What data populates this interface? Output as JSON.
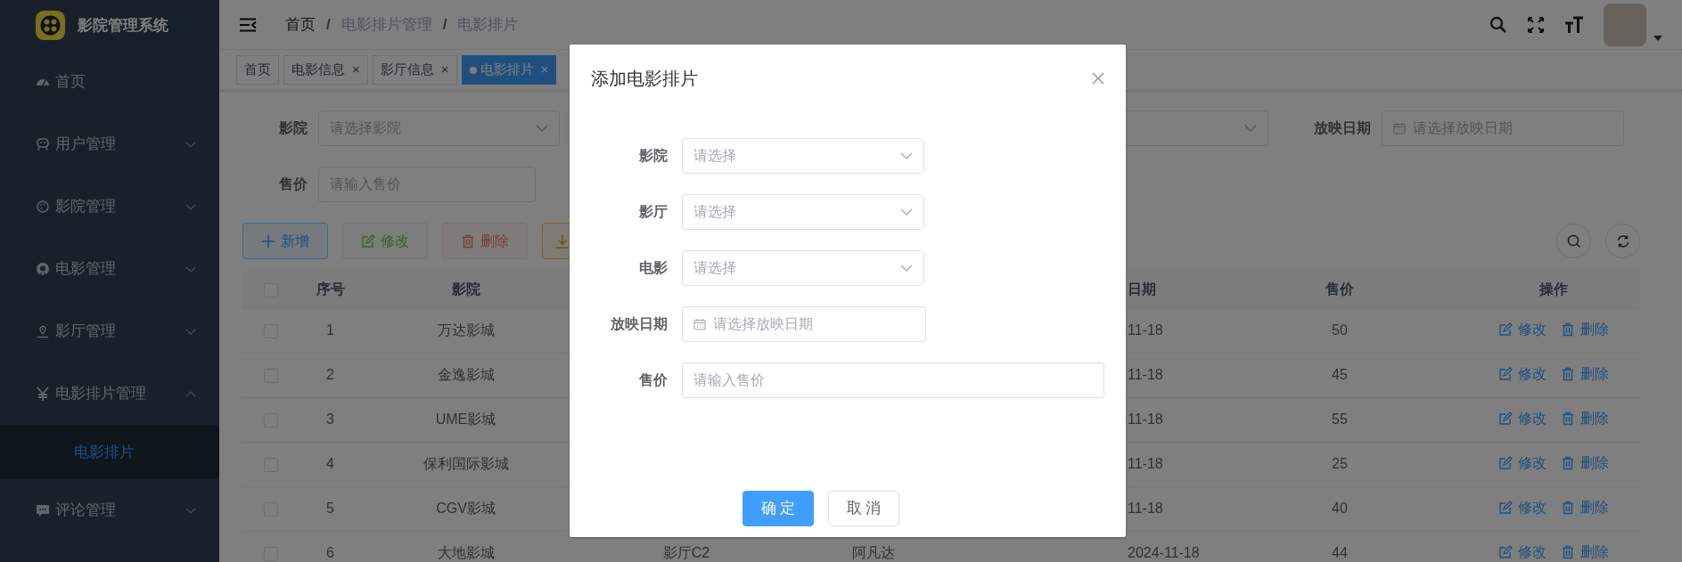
{
  "sidebar": {
    "title": "影院管理系统",
    "items": [
      {
        "label": "首页"
      },
      {
        "label": "用户管理",
        "expanded": false
      },
      {
        "label": "影院管理",
        "expanded": false
      },
      {
        "label": "电影管理",
        "expanded": false
      },
      {
        "label": "影厅管理",
        "expanded": false
      },
      {
        "label": "电影排片管理",
        "expanded": true,
        "children": [
          {
            "label": "电影排片",
            "selected": true
          }
        ]
      },
      {
        "label": "评论管理",
        "expanded": false
      }
    ]
  },
  "breadcrumb": [
    {
      "label": "首页",
      "kind": "link"
    },
    {
      "separator": "/",
      "label": "电影排片管理",
      "kind": "plain"
    },
    {
      "separator": "/",
      "label": "电影排片",
      "kind": "plain"
    }
  ],
  "tabs": [
    {
      "label": "首页",
      "selected": false
    },
    {
      "label": "电影信息",
      "close": "×",
      "selected": false
    },
    {
      "label": "影厅信息",
      "close": "×",
      "selected": false
    },
    {
      "label": "电影排片",
      "close": "×",
      "selected": true
    }
  ],
  "filter_rows": [
    [
      {
        "label": "影院",
        "kind": "select",
        "placeholder": "请选择影院"
      },
      {
        "kind": "select"
      },
      {
        "label": "放映日期",
        "kind": "date",
        "placeholder": "请选择放映日期"
      }
    ],
    [
      {
        "label": "售价",
        "kind": "input",
        "placeholder": "请输入售价"
      }
    ]
  ],
  "toolbar": [
    {
      "label": "新增",
      "kind": "primary",
      "disabled": false
    },
    {
      "label": "修改",
      "kind": "success",
      "disabled": true
    },
    {
      "label": "删除",
      "kind": "danger",
      "disabled": true
    },
    {
      "kind": "warning",
      "disabled": false
    }
  ],
  "table": {
    "header": {
      "checked": false,
      "index": "序号",
      "cinema": "影院",
      "date": "日期",
      "price": "售价",
      "actions": "操作"
    },
    "rows": [
      {
        "checked": false,
        "index": "1",
        "cinema": "万达影城",
        "date": "11-18",
        "price": "50",
        "actions": [
          {
            "label": "修改",
            "kind": "edit"
          },
          {
            "label": "删除",
            "kind": "delete"
          }
        ]
      },
      {
        "checked": false,
        "index": "2",
        "cinema": "金逸影城",
        "date": "11-18",
        "price": "45",
        "actions": [
          {
            "label": "修改",
            "kind": "edit"
          },
          {
            "label": "删除",
            "kind": "delete"
          }
        ]
      },
      {
        "checked": false,
        "index": "3",
        "cinema": "UME影城",
        "date": "11-18",
        "price": "55",
        "actions": [
          {
            "label": "修改",
            "kind": "edit"
          },
          {
            "label": "删除",
            "kind": "delete"
          }
        ]
      },
      {
        "checked": false,
        "index": "4",
        "cinema": "保利国际影城",
        "date": "11-18",
        "price": "25",
        "actions": [
          {
            "label": "修改",
            "kind": "edit"
          },
          {
            "label": "删除",
            "kind": "delete"
          }
        ]
      },
      {
        "checked": false,
        "index": "5",
        "cinema": "CGV影城",
        "date": "11-18",
        "price": "40",
        "actions": [
          {
            "label": "修改",
            "kind": "edit"
          },
          {
            "label": "删除",
            "kind": "delete"
          }
        ]
      },
      {
        "checked": false,
        "index": "6",
        "cinema": "大地影城",
        "hall": "影厅C2",
        "movie": "阿凡达",
        "date": "2024-11-18",
        "price": "44",
        "actions": [
          {
            "label": "修改",
            "kind": "edit"
          },
          {
            "label": "删除",
            "kind": "delete"
          }
        ]
      }
    ]
  },
  "dialog": {
    "title": "添加电影排片",
    "fields": [
      {
        "label": "影院",
        "kind": "select",
        "placeholder": "请选择"
      },
      {
        "label": "影厅",
        "kind": "select",
        "placeholder": "请选择"
      },
      {
        "label": "电影",
        "kind": "select",
        "placeholder": "请选择"
      },
      {
        "label": "放映日期",
        "kind": "date",
        "placeholder": "请选择放映日期"
      },
      {
        "label": "售价",
        "kind": "input",
        "placeholder": "请输入售价"
      }
    ],
    "buttons": [
      {
        "label": "确 定",
        "kind": "primary"
      },
      {
        "label": "取 消",
        "kind": "default"
      }
    ]
  }
}
